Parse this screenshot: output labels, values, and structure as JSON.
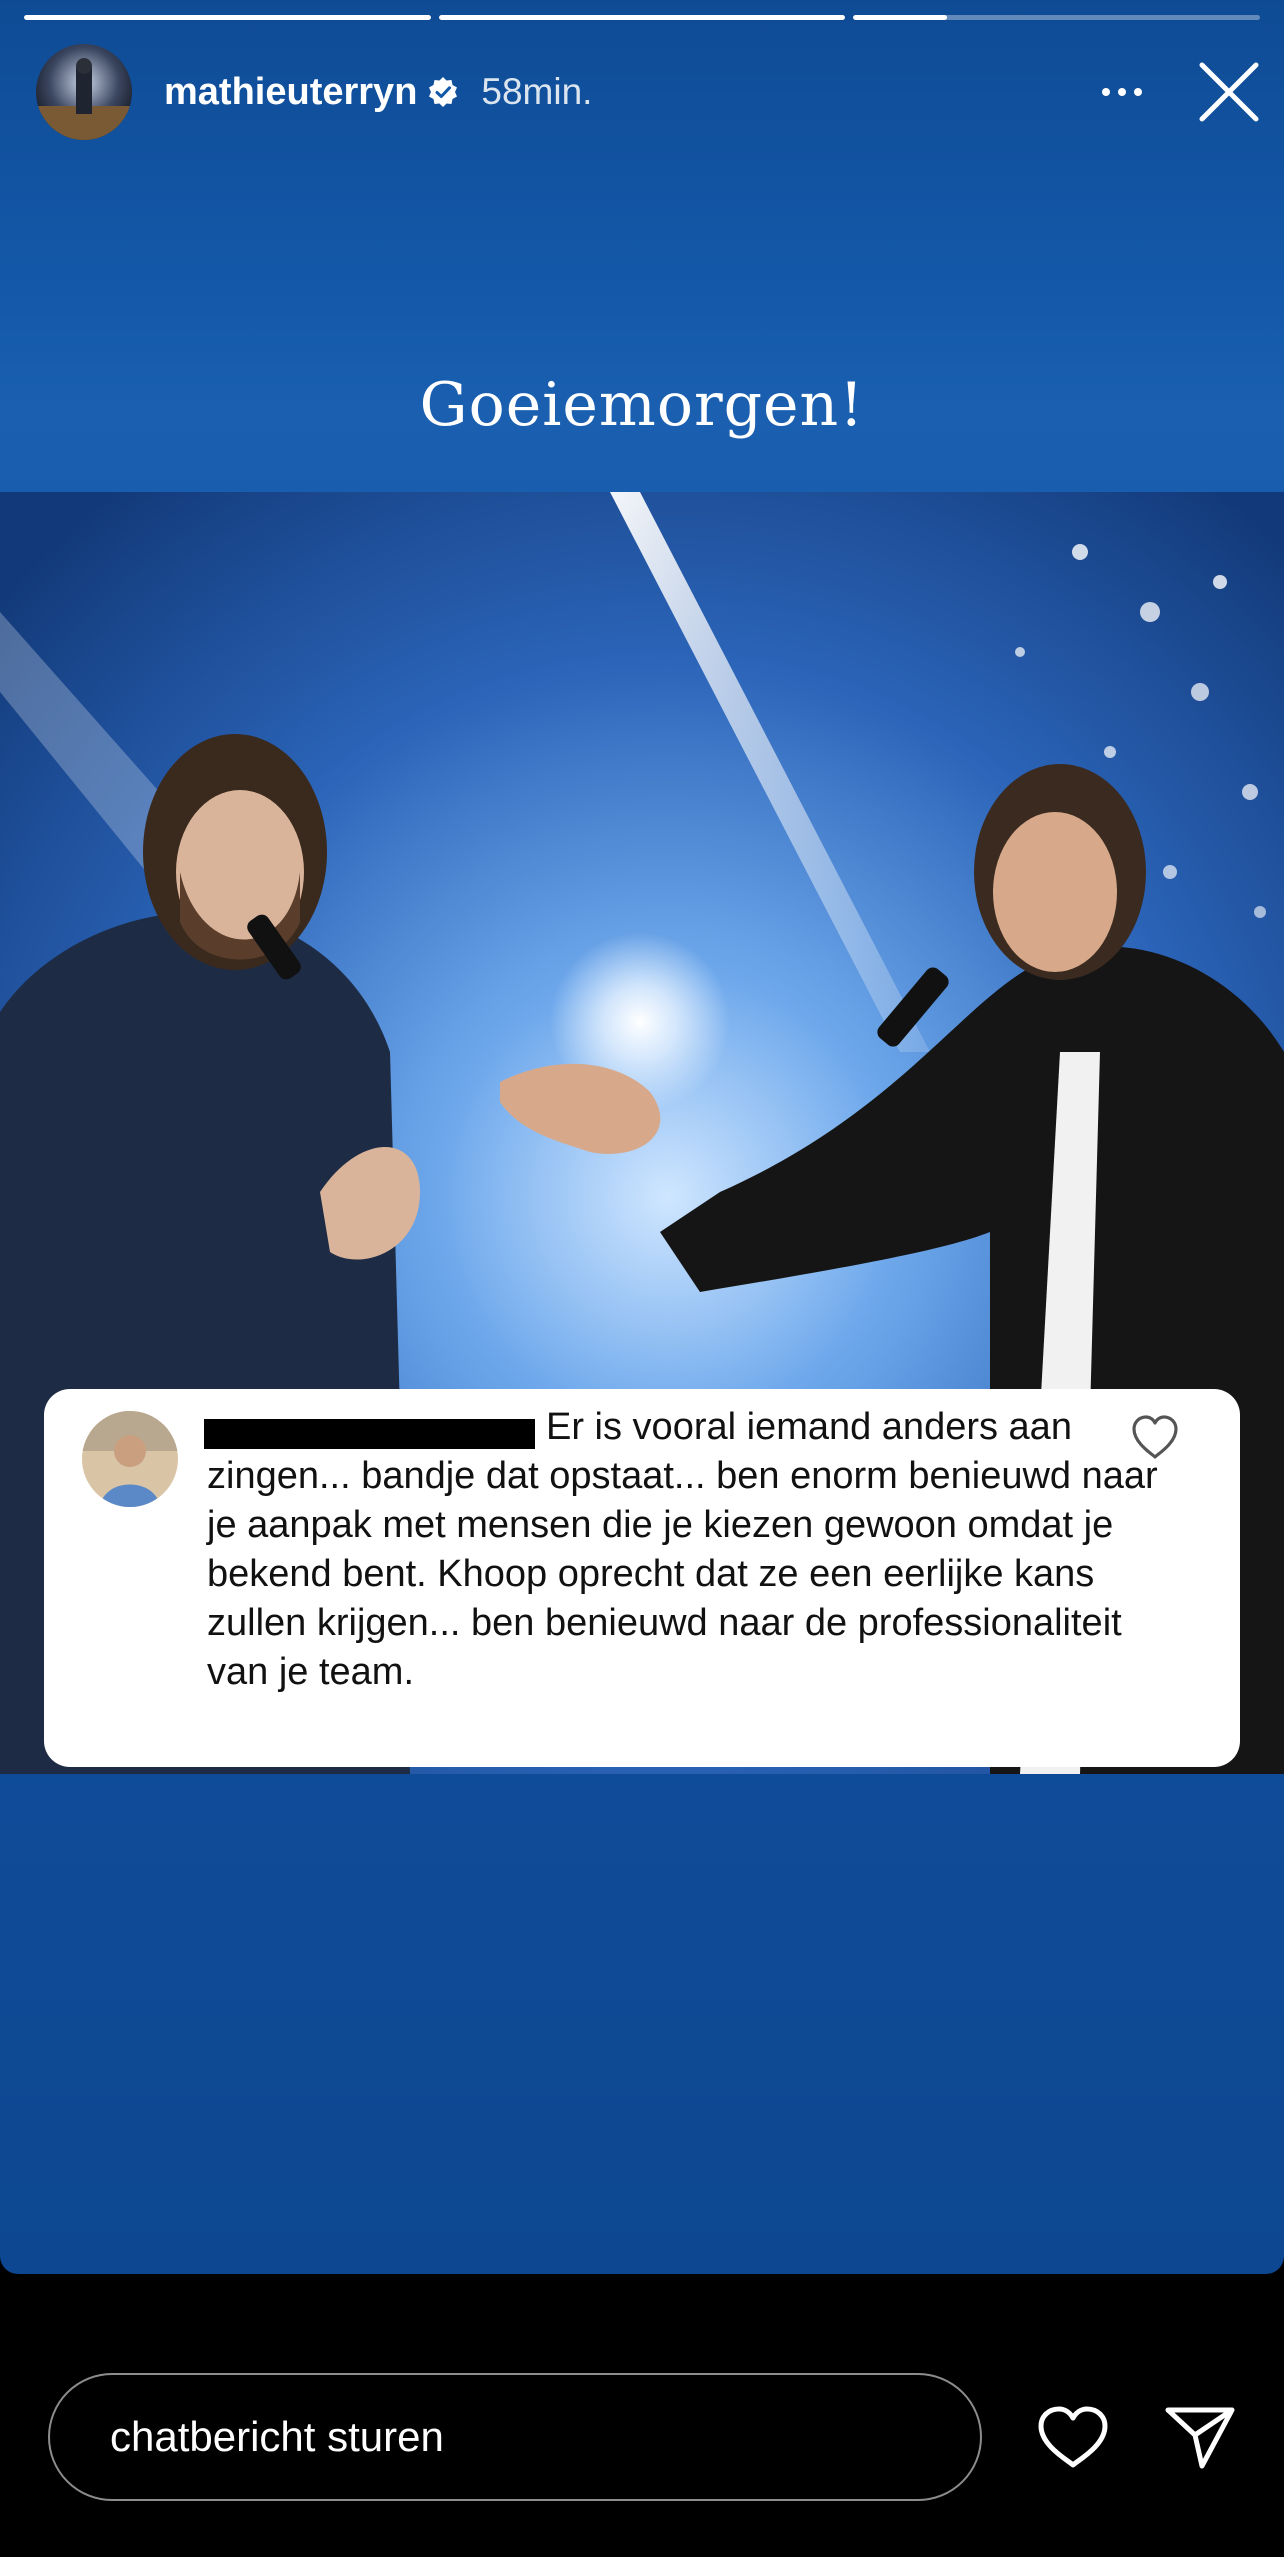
{
  "story": {
    "progress": [
      1.0,
      1.0,
      0.23
    ],
    "username": "mathieuterryn",
    "time": "58min.",
    "caption": "Goeiemorgen!"
  },
  "comment": {
    "text": "Er is vooral iemand anders aan zingen... bandje dat opstaat... ben enorm benieuwd naar je aanpak met mensen die je kiezen gewoon omdat je bekend bent. Khoop oprecht dat ze een eerlijke kans zullen krijgen... ben benieuwd naar de professionaliteit van je team."
  },
  "reply": {
    "placeholder": "chatbericht sturen"
  },
  "icons": {
    "verified": "verified-badge-icon",
    "more": "more-options-icon",
    "close": "close-icon",
    "like": "heart-icon",
    "send": "paper-plane-icon"
  },
  "colors": {
    "background": "#000000",
    "story_blue": "#1358a8",
    "text": "#ffffff"
  }
}
